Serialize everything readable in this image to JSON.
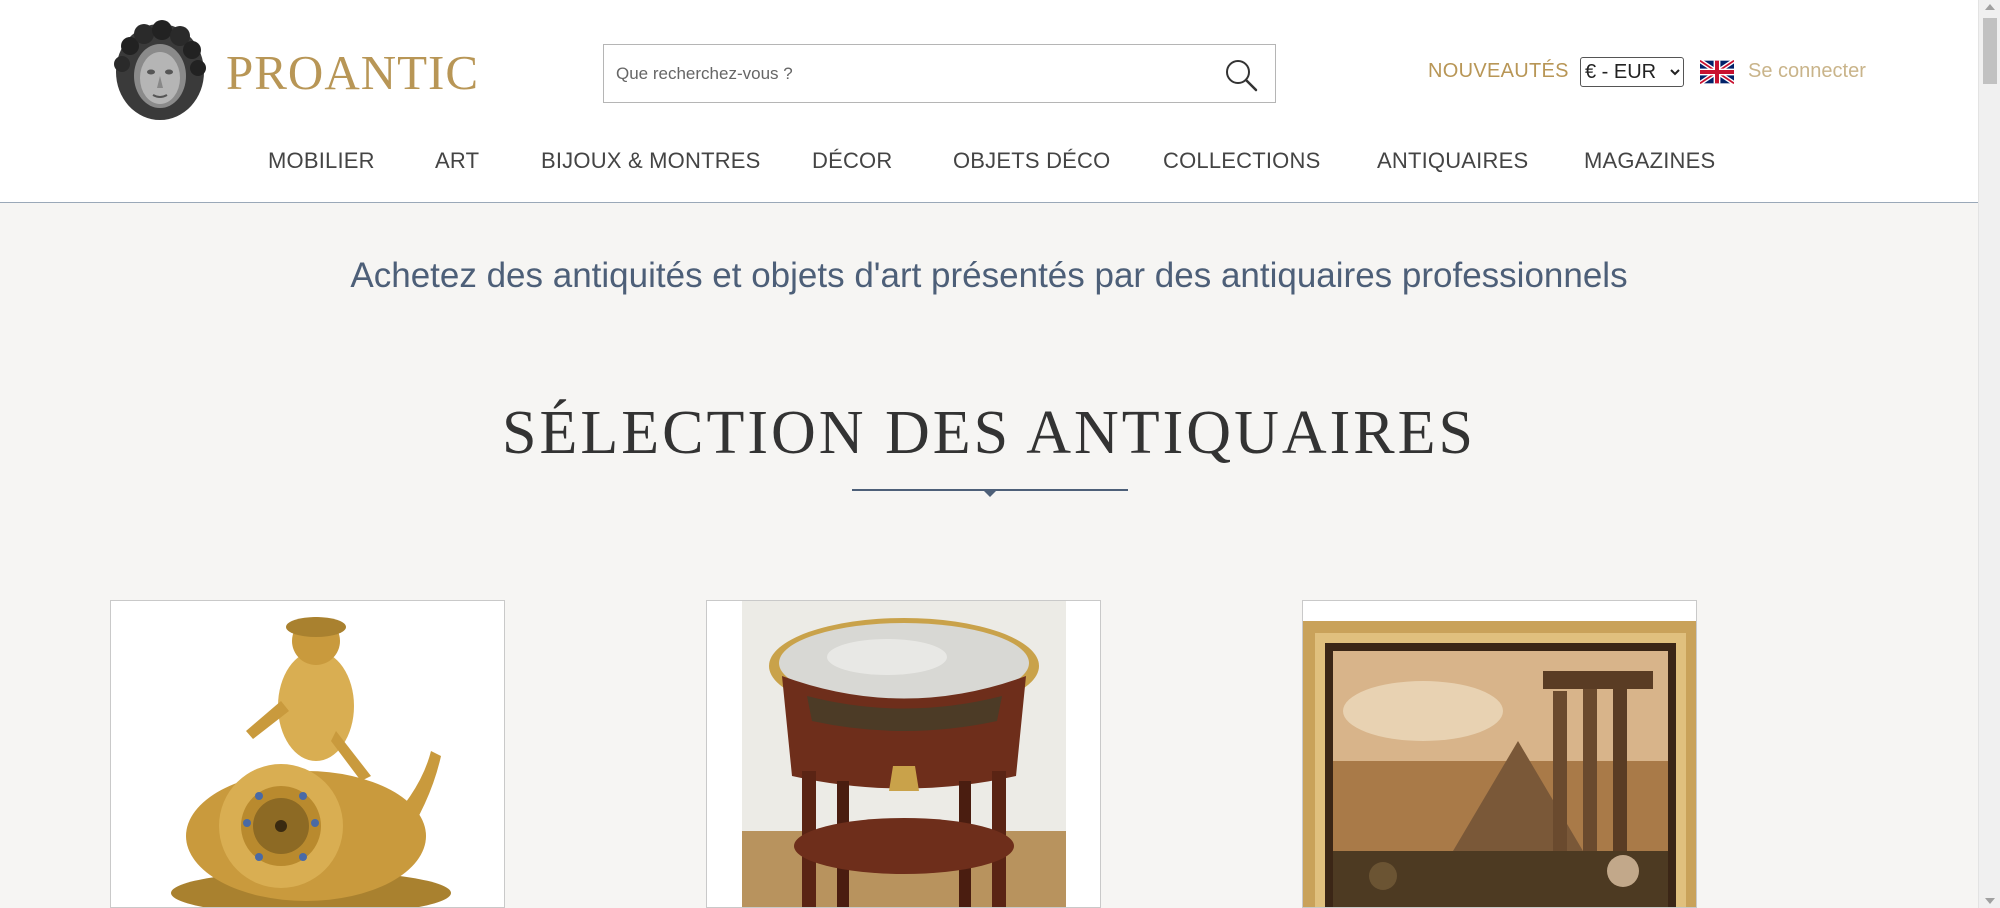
{
  "header": {
    "logo_text": "PROANTIC",
    "search": {
      "placeholder": "Que recherchez-vous ?",
      "value": ""
    },
    "new_label": "NOUVEAUTÉS",
    "currency": {
      "selected": "€ - EUR"
    },
    "login_label": "Se connecter"
  },
  "nav": {
    "items": [
      {
        "label": "MOBILIER"
      },
      {
        "label": "ART"
      },
      {
        "label": "BIJOUX & MONTRES"
      },
      {
        "label": "DÉCOR"
      },
      {
        "label": "OBJETS DÉCO"
      },
      {
        "label": "COLLECTIONS"
      },
      {
        "label": "ANTIQUAIRES"
      },
      {
        "label": "MAGAZINES"
      }
    ]
  },
  "main": {
    "tagline": "Achetez des antiquités et objets d'art présentés par des antiquaires professionnels",
    "section_title": "SÉLECTION DES ANTIQUAIRES"
  },
  "colors": {
    "brand_gold": "#b89656",
    "tagline_blue": "#4d5f78",
    "background": "#f6f5f3"
  },
  "icons": [
    "logo-bust-icon",
    "search-icon",
    "uk-flag-icon",
    "divider-diamond-icon"
  ]
}
